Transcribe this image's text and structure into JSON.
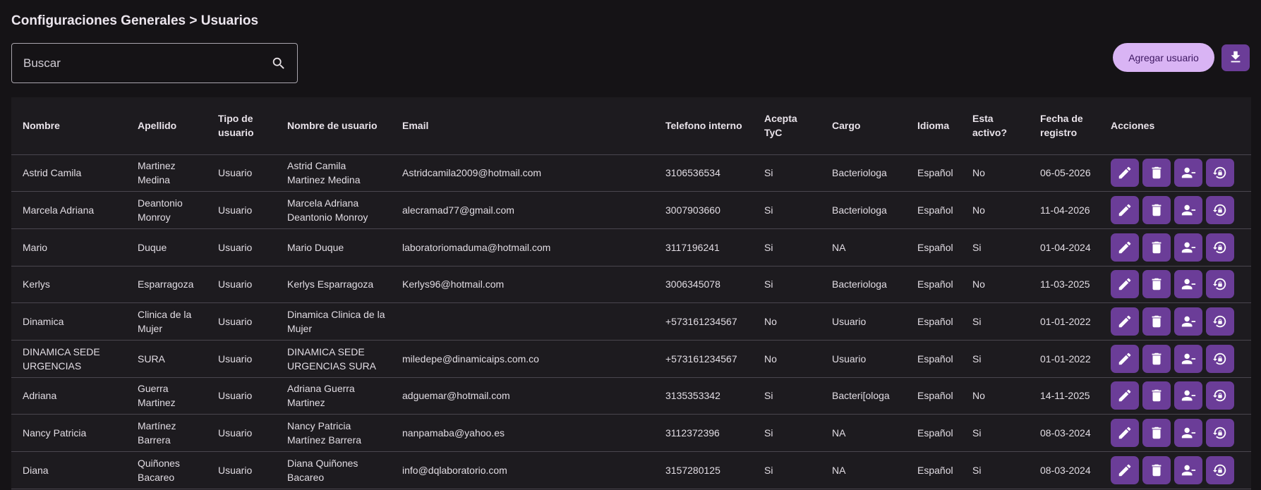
{
  "breadcrumb": "Configuraciones Generales > Usuarios",
  "search": {
    "placeholder": "Buscar",
    "value": "",
    "icon": "search-icon"
  },
  "toolbar": {
    "add_label": "Agregar usuario",
    "download_icon": "download-icon"
  },
  "colors": {
    "accent": "#6b3d98",
    "button_light": "#d9b4f4",
    "background": "#151316",
    "table_bg": "#1d1b1f"
  },
  "table": {
    "columns": [
      "Nombre",
      "Apellido",
      "Tipo de usuario",
      "Nombre de usuario",
      "Email",
      "Telefono interno",
      "Acepta TyC",
      "Cargo",
      "Idioma",
      "Esta activo?",
      "Fecha de registro",
      "Acciones"
    ],
    "action_icons": [
      "edit-icon",
      "delete-icon",
      "remove-user-icon",
      "reset-password-icon"
    ],
    "rows": [
      [
        "Astrid Camila",
        "Martinez Medina",
        "Usuario",
        "Astrid Camila Martinez Medina",
        "Astridcamila2009@hotmail.com",
        "3106536534",
        "Si",
        "Bacteriologa",
        "Español",
        "No",
        "06-05-2026"
      ],
      [
        "Marcela Adriana",
        "Deantonio Monroy",
        "Usuario",
        "Marcela Adriana Deantonio Monroy",
        "alecramad77@gmail.com",
        "3007903660",
        "Si",
        "Bacteriologa",
        "Español",
        "No",
        "11-04-2026"
      ],
      [
        "Mario",
        "Duque",
        "Usuario",
        "Mario Duque",
        "laboratoriomaduma@hotmail.com",
        "3117196241",
        "Si",
        "NA",
        "Español",
        "Si",
        "01-04-2024"
      ],
      [
        "Kerlys",
        "Esparragoza",
        "Usuario",
        "Kerlys Esparragoza",
        "Kerlys96@hotmail.com",
        "3006345078",
        "Si",
        "Bacteriologa",
        "Español",
        "No",
        "11-03-2025"
      ],
      [
        "Dinamica",
        "Clinica de la Mujer",
        "Usuario",
        "Dinamica Clinica de la Mujer",
        "",
        "+573161234567",
        "No",
        "Usuario",
        "Español",
        "Si",
        "01-01-2022"
      ],
      [
        "DINAMICA SEDE URGENCIAS",
        "SURA",
        "Usuario",
        "DINAMICA SEDE URGENCIAS SURA",
        "miledepe@dinamicaips.com.co",
        "+573161234567",
        "No",
        "Usuario",
        "Español",
        "Si",
        "01-01-2022"
      ],
      [
        "Adriana",
        "Guerra Martinez",
        "Usuario",
        "Adriana Guerra Martinez",
        "adguemar@hotmail.com",
        "3135353342",
        "Si",
        "Bacteri[ologa",
        "Español",
        "No",
        "14-11-2025"
      ],
      [
        "Nancy Patricia",
        "Martínez Barrera",
        "Usuario",
        "Nancy Patricia Martínez Barrera",
        "nanpamaba@yahoo.es",
        "3112372396",
        "Si",
        "NA",
        "Español",
        "Si",
        "08-03-2024"
      ],
      [
        "Diana",
        "Quiñones Bacareo",
        "Usuario",
        "Diana Quiñones Bacareo",
        "info@dqlaboratorio.com",
        "3157280125",
        "Si",
        "NA",
        "Español",
        "Si",
        "08-03-2024"
      ]
    ]
  }
}
